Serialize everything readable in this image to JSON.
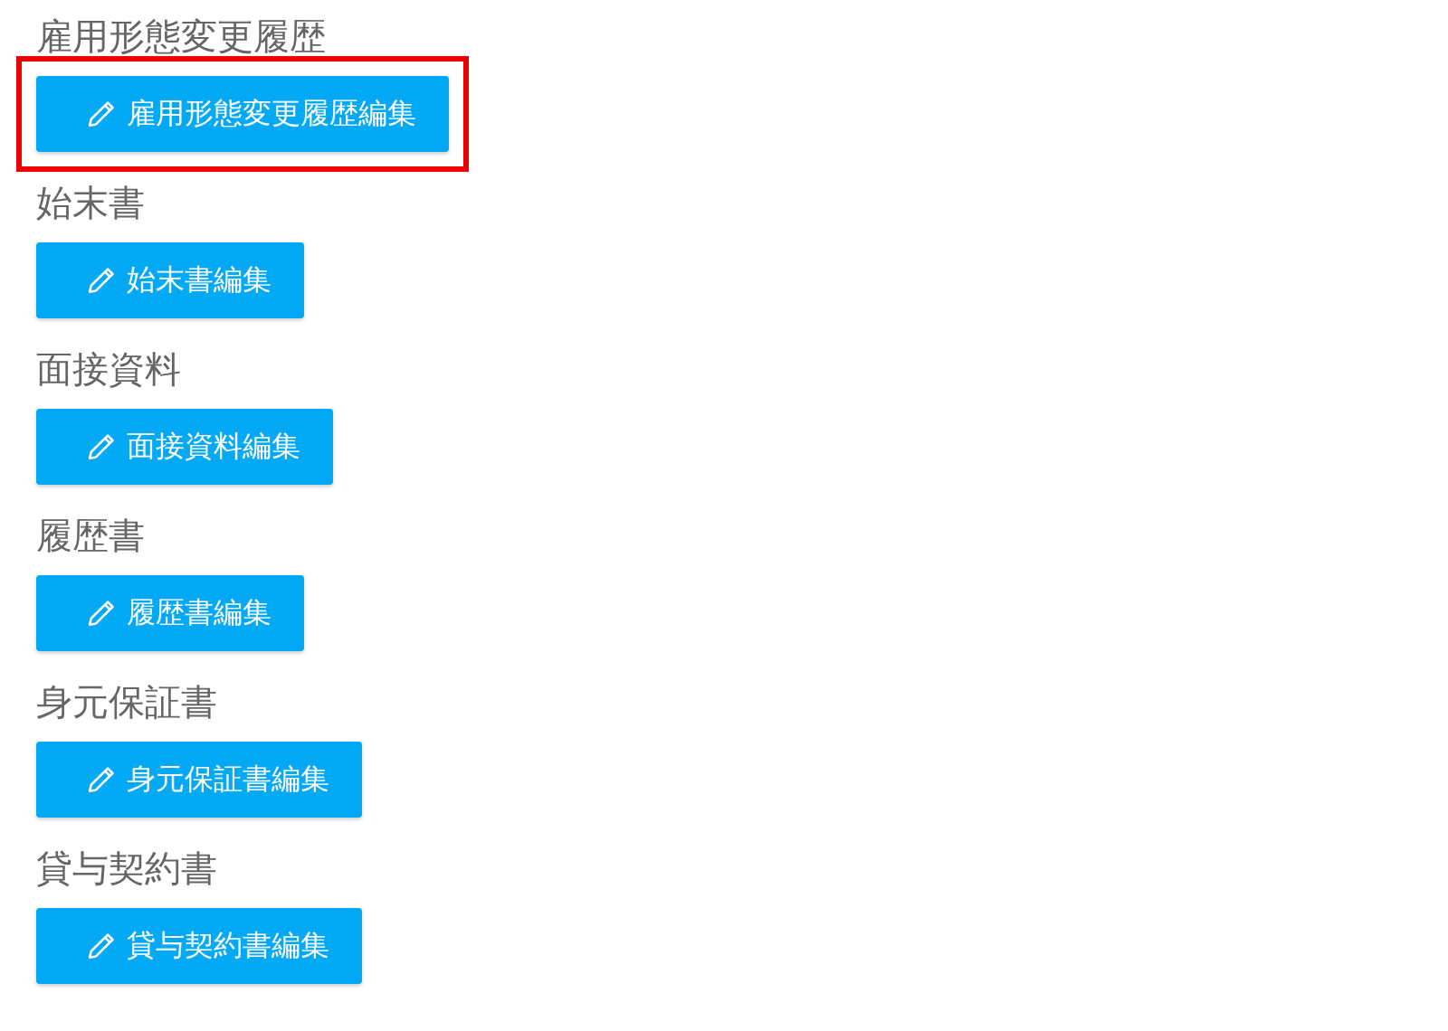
{
  "sections": [
    {
      "title": "雇用形態変更履歴",
      "button": "雇用形態変更履歴編集",
      "highlighted": true
    },
    {
      "title": "始末書",
      "button": "始末書編集",
      "highlighted": false
    },
    {
      "title": "面接資料",
      "button": "面接資料編集",
      "highlighted": false
    },
    {
      "title": "履歴書",
      "button": "履歴書編集",
      "highlighted": false
    },
    {
      "title": "身元保証書",
      "button": "身元保証書編集",
      "highlighted": false
    },
    {
      "title": "貸与契約書",
      "button": "貸与契約書編集",
      "highlighted": false
    }
  ]
}
